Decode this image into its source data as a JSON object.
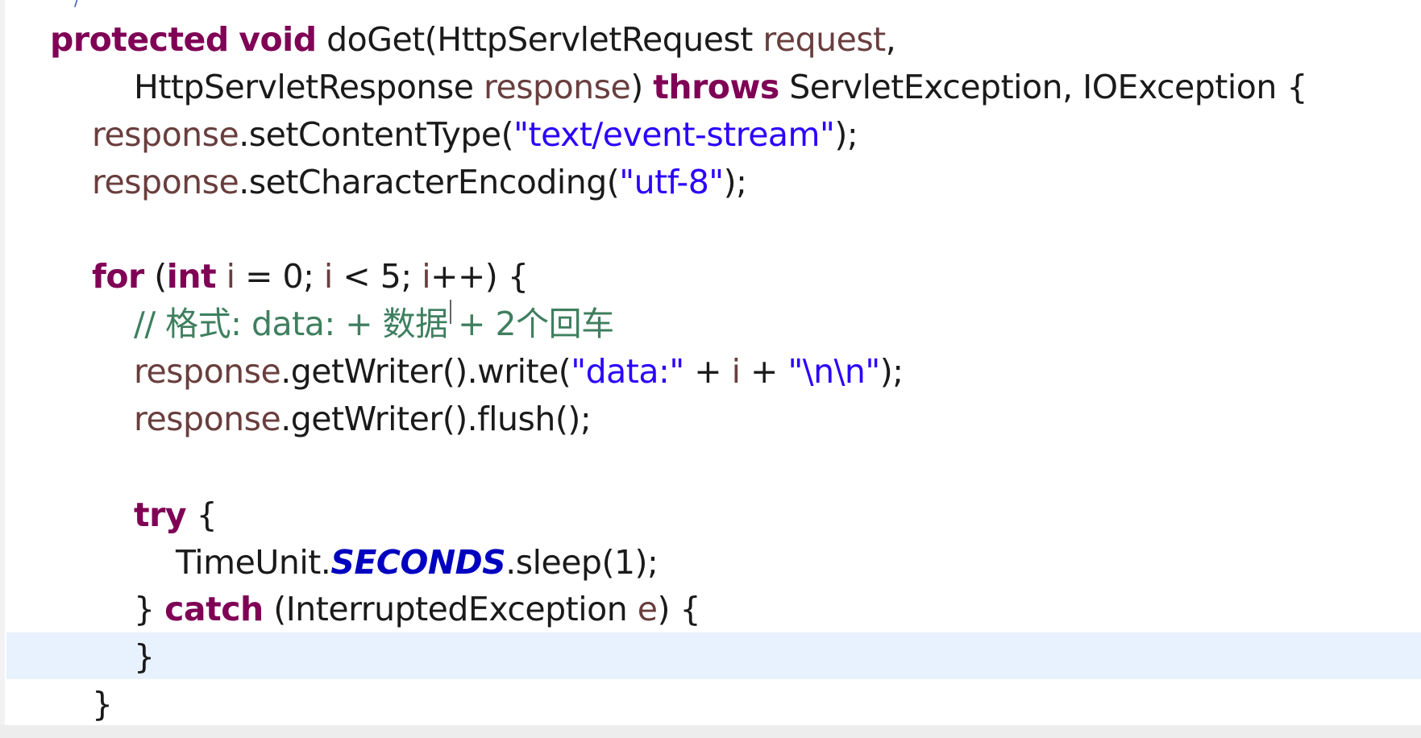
{
  "editor": {
    "colors": {
      "keyword": "#7f0055",
      "variable": "#6a3e3e",
      "string": "#2a00ff",
      "comment": "#3f7f5f",
      "constant": "#0000c0",
      "current_line": "#e8f2fe"
    },
    "lines": [
      {
        "id": "method-signature",
        "tokens": [
          {
            "type": "kw",
            "text": "protected"
          },
          {
            "type": "plain",
            "text": " "
          },
          {
            "type": "kw",
            "text": "void"
          },
          {
            "type": "plain",
            "text": " doGet(HttpServletRequest "
          },
          {
            "type": "var",
            "text": "request"
          },
          {
            "type": "plain",
            "text": ","
          }
        ]
      },
      {
        "id": "method-signature-cont",
        "tokens": [
          {
            "type": "plain",
            "text": "HttpServletResponse "
          },
          {
            "type": "var",
            "text": "response"
          },
          {
            "type": "plain",
            "text": ") "
          },
          {
            "type": "kw",
            "text": "throws"
          },
          {
            "type": "plain",
            "text": " ServletException, IOException {"
          }
        ]
      },
      {
        "id": "set-content-type",
        "tokens": [
          {
            "type": "var",
            "text": "response"
          },
          {
            "type": "plain",
            "text": ".setContentType("
          },
          {
            "type": "str",
            "text": "\"text/event-stream\""
          },
          {
            "type": "plain",
            "text": ");"
          }
        ]
      },
      {
        "id": "set-encoding",
        "tokens": [
          {
            "type": "var",
            "text": "response"
          },
          {
            "type": "plain",
            "text": ".setCharacterEncoding("
          },
          {
            "type": "str",
            "text": "\"utf-8\""
          },
          {
            "type": "plain",
            "text": ");"
          }
        ]
      },
      {
        "id": "for-loop",
        "tokens": [
          {
            "type": "kw",
            "text": "for"
          },
          {
            "type": "plain",
            "text": " ("
          },
          {
            "type": "kw",
            "text": "int"
          },
          {
            "type": "plain",
            "text": " "
          },
          {
            "type": "var",
            "text": "i"
          },
          {
            "type": "plain",
            "text": " = 0; "
          },
          {
            "type": "var",
            "text": "i"
          },
          {
            "type": "plain",
            "text": " < 5; "
          },
          {
            "type": "var",
            "text": "i"
          },
          {
            "type": "plain",
            "text": "++) {"
          }
        ]
      },
      {
        "id": "comment",
        "tokens": [
          {
            "type": "cmt",
            "text": "// 格式: data: + 数据 + 2个回车"
          }
        ]
      },
      {
        "id": "write-data",
        "tokens": [
          {
            "type": "var",
            "text": "response"
          },
          {
            "type": "plain",
            "text": ".getWriter().write("
          },
          {
            "type": "str",
            "text": "\"data:\""
          },
          {
            "type": "plain",
            "text": " + "
          },
          {
            "type": "var",
            "text": "i"
          },
          {
            "type": "plain",
            "text": " + "
          },
          {
            "type": "str",
            "text": "\"\\n\\n\""
          },
          {
            "type": "plain",
            "text": ");"
          }
        ]
      },
      {
        "id": "flush",
        "tokens": [
          {
            "type": "var",
            "text": "response"
          },
          {
            "type": "plain",
            "text": ".getWriter().flush();"
          }
        ]
      },
      {
        "id": "try",
        "tokens": [
          {
            "type": "kw",
            "text": "try"
          },
          {
            "type": "plain",
            "text": " {"
          }
        ]
      },
      {
        "id": "sleep",
        "tokens": [
          {
            "type": "plain",
            "text": "TimeUnit."
          },
          {
            "type": "const",
            "text": "SECONDS"
          },
          {
            "type": "plain",
            "text": ".sleep(1);"
          }
        ]
      },
      {
        "id": "catch",
        "tokens": [
          {
            "type": "plain",
            "text": "} "
          },
          {
            "type": "kw",
            "text": "catch"
          },
          {
            "type": "plain",
            "text": " (InterruptedException "
          },
          {
            "type": "var",
            "text": "e"
          },
          {
            "type": "plain",
            "text": ") {"
          }
        ]
      },
      {
        "id": "catch-close",
        "tokens": [
          {
            "type": "plain",
            "text": "}"
          }
        ]
      },
      {
        "id": "for-close",
        "tokens": [
          {
            "type": "plain",
            "text": "}"
          }
        ]
      }
    ]
  }
}
